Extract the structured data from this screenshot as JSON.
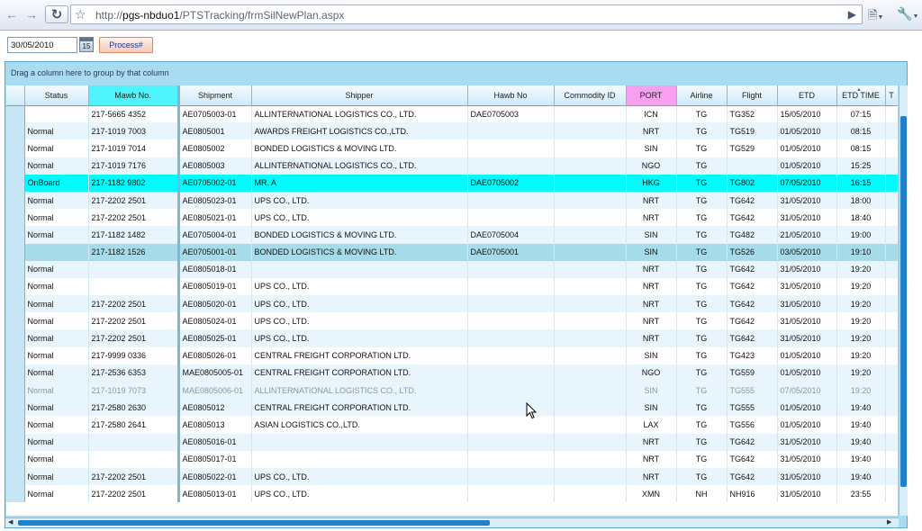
{
  "browser": {
    "url_scheme": "http://",
    "url_host": "pgs-nbduo1",
    "url_path": "/PTSTracking/frmSilNewPlan.aspx",
    "icons": [
      "back-arrow-icon",
      "forward-arrow-icon",
      "reload-icon",
      "star-icon",
      "play-icon",
      "page-icon",
      "wrench-icon"
    ]
  },
  "controls": {
    "date_value": "30/05/2010",
    "calendar_label": "15",
    "process_label": "Process#"
  },
  "grid": {
    "group_panel_text": "Drag a column here to group by that column",
    "columns": [
      "Status",
      "Mawb No.",
      "Shipment",
      "Shipper",
      "Hawb No",
      "Commodity ID",
      "PORT",
      "Airline",
      "Flight",
      "ETD",
      "ETD TIME",
      "T"
    ],
    "header_colors": {
      "Mawb No.": "#4ff3fb",
      "PORT": "#f7a0ef"
    },
    "rows": [
      {
        "status": "",
        "mawb": "217-5665 4352",
        "shipment": "AE0705003-01",
        "shipper": "ALLINTERNATIONAL LOGISTICS CO., LTD.",
        "hawb": "DAE0705003",
        "commodity": "",
        "port": "ICN",
        "airline": "TG",
        "flight": "TG352",
        "etd": "15/05/2010",
        "etd_time": "07:15"
      },
      {
        "status": "Normal",
        "mawb": "217-1019 7003",
        "shipment": "AE0805001",
        "shipper": "AWARDS FREIGHT LOGISTICS CO.,LTD.",
        "hawb": "",
        "commodity": "",
        "port": "NRT",
        "airline": "TG",
        "flight": "TG519",
        "etd": "01/05/2010",
        "etd_time": "08:15"
      },
      {
        "status": "Normal",
        "mawb": "217-1019 7014",
        "shipment": "AE0805002",
        "shipper": "BONDED LOGISTICS & MOVING LTD.",
        "hawb": "",
        "commodity": "",
        "port": "SIN",
        "airline": "TG",
        "flight": "TG529",
        "etd": "01/05/2010",
        "etd_time": "08:15"
      },
      {
        "status": "Normal",
        "mawb": "217-1019 7176",
        "shipment": "AE0805003",
        "shipper": "ALLINTERNATIONAL LOGISTICS CO., LTD.",
        "hawb": "",
        "commodity": "",
        "port": "NGO",
        "airline": "TG",
        "flight": "",
        "etd": "01/05/2010",
        "etd_time": "15:25"
      },
      {
        "status": "OnBoard",
        "mawb": "217-1182 9802",
        "shipment": "AE0705002-01",
        "shipper": "MR. A",
        "hawb": "DAE0705002",
        "commodity": "",
        "port": "HKG",
        "airline": "TG",
        "flight": "TG802",
        "etd": "07/05/2010",
        "etd_time": "16:15",
        "style": "onboard"
      },
      {
        "status": "Normal",
        "mawb": "217-2202 2501",
        "shipment": "AE0805023-01",
        "shipper": "UPS CO., LTD.",
        "hawb": "",
        "commodity": "",
        "port": "NRT",
        "airline": "TG",
        "flight": "TG642",
        "etd": "31/05/2010",
        "etd_time": "18:00"
      },
      {
        "status": "Normal",
        "mawb": "217-2202 2501",
        "shipment": "AE0805021-01",
        "shipper": "UPS CO., LTD.",
        "hawb": "",
        "commodity": "",
        "port": "NRT",
        "airline": "TG",
        "flight": "TG642",
        "etd": "31/05/2010",
        "etd_time": "18:40"
      },
      {
        "status": "Normal",
        "mawb": "217-1182 1482",
        "shipment": "AE0705004-01",
        "shipper": "BONDED LOGISTICS & MOVING LTD.",
        "hawb": "DAE0705004",
        "commodity": "",
        "port": "SIN",
        "airline": "TG",
        "flight": "TG482",
        "etd": "21/05/2010",
        "etd_time": "19:00"
      },
      {
        "status": "",
        "mawb": "217-1182 1526",
        "shipment": "AE0705001-01",
        "shipper": "BONDED LOGISTICS & MOVING LTD.",
        "hawb": "DAE0705001",
        "commodity": "",
        "port": "SIN",
        "airline": "TG",
        "flight": "TG526",
        "etd": "03/05/2010",
        "etd_time": "19:10",
        "style": "selected"
      },
      {
        "status": "Normal",
        "mawb": "",
        "shipment": "AE0805018-01",
        "shipper": "",
        "hawb": "",
        "commodity": "",
        "port": "NRT",
        "airline": "TG",
        "flight": "TG642",
        "etd": "31/05/2010",
        "etd_time": "19:20"
      },
      {
        "status": "Normal",
        "mawb": "",
        "shipment": "AE0805019-01",
        "shipper": "UPS CO., LTD.",
        "hawb": "",
        "commodity": "",
        "port": "NRT",
        "airline": "TG",
        "flight": "TG642",
        "etd": "31/05/2010",
        "etd_time": "19:20"
      },
      {
        "status": "Normal",
        "mawb": "217-2202 2501",
        "shipment": "AE0805020-01",
        "shipper": "UPS CO., LTD.",
        "hawb": "",
        "commodity": "",
        "port": "NRT",
        "airline": "TG",
        "flight": "TG642",
        "etd": "31/05/2010",
        "etd_time": "19:20"
      },
      {
        "status": "Normal",
        "mawb": "217-2202 2501",
        "shipment": "AE0805024-01",
        "shipper": "UPS CO., LTD.",
        "hawb": "",
        "commodity": "",
        "port": "NRT",
        "airline": "TG",
        "flight": "TG642",
        "etd": "31/05/2010",
        "etd_time": "19:20"
      },
      {
        "status": "Normal",
        "mawb": "217-2202 2501",
        "shipment": "AE0805025-01",
        "shipper": "UPS CO., LTD.",
        "hawb": "",
        "commodity": "",
        "port": "NRT",
        "airline": "TG",
        "flight": "TG642",
        "etd": "31/05/2010",
        "etd_time": "19:20"
      },
      {
        "status": "Normal",
        "mawb": "217-9999 0336",
        "shipment": "AE0805026-01",
        "shipper": "CENTRAL FREIGHT CORPORATION LTD.",
        "hawb": "",
        "commodity": "",
        "port": "SIN",
        "airline": "TG",
        "flight": "TG423",
        "etd": "01/05/2010",
        "etd_time": "19:20"
      },
      {
        "status": "Normal",
        "mawb": "217-2536 6353",
        "shipment": "MAE0805005-01",
        "shipper": "CENTRAL FREIGHT CORPORATION LTD.",
        "hawb": "",
        "commodity": "",
        "port": "NGO",
        "airline": "TG",
        "flight": "TG559",
        "etd": "01/05/2010",
        "etd_time": "19:20"
      },
      {
        "status": "Normal",
        "mawb": "217-1019 7073",
        "shipment": "MAE0805006-01",
        "shipper": "ALLINTERNATIONAL LOGISTICS CO., LTD.",
        "hawb": "",
        "commodity": "",
        "port": "SIN",
        "airline": "TG",
        "flight": "TG555",
        "etd": "07/05/2010",
        "etd_time": "19:20",
        "style": "dim"
      },
      {
        "status": "Normal",
        "mawb": "217-2580 2630",
        "shipment": "AE0805012",
        "shipper": "CENTRAL FREIGHT CORPORATION LTD.",
        "hawb": "",
        "commodity": "",
        "port": "SIN",
        "airline": "TG",
        "flight": "TG555",
        "etd": "01/05/2010",
        "etd_time": "19:40"
      },
      {
        "status": "Normal",
        "mawb": "217-2580 2641",
        "shipment": "AE0805013",
        "shipper": "ASIAN LOGISTICS CO.,LTD.",
        "hawb": "",
        "commodity": "",
        "port": "LAX",
        "airline": "TG",
        "flight": "TG556",
        "etd": "01/05/2010",
        "etd_time": "19:40"
      },
      {
        "status": "Normal",
        "mawb": "",
        "shipment": "AE0805016-01",
        "shipper": "",
        "hawb": "",
        "commodity": "",
        "port": "NRT",
        "airline": "TG",
        "flight": "TG642",
        "etd": "31/05/2010",
        "etd_time": "19:40"
      },
      {
        "status": "Normal",
        "mawb": "",
        "shipment": "AE0805017-01",
        "shipper": "",
        "hawb": "",
        "commodity": "",
        "port": "NRT",
        "airline": "TG",
        "flight": "TG642",
        "etd": "31/05/2010",
        "etd_time": "19:40"
      },
      {
        "status": "Normal",
        "mawb": "217-2202 2501",
        "shipment": "AE0805022-01",
        "shipper": "UPS CO., LTD.",
        "hawb": "",
        "commodity": "",
        "port": "NRT",
        "airline": "TG",
        "flight": "TG642",
        "etd": "31/05/2010",
        "etd_time": "19:40"
      },
      {
        "status": "Normal",
        "mawb": "217-2202 2501",
        "shipment": "AE0805013-01",
        "shipper": "UPS CO., LTD.",
        "hawb": "",
        "commodity": "",
        "port": "XMN",
        "airline": "NH",
        "flight": "NH916",
        "etd": "31/05/2010",
        "etd_time": "23:55"
      }
    ]
  }
}
